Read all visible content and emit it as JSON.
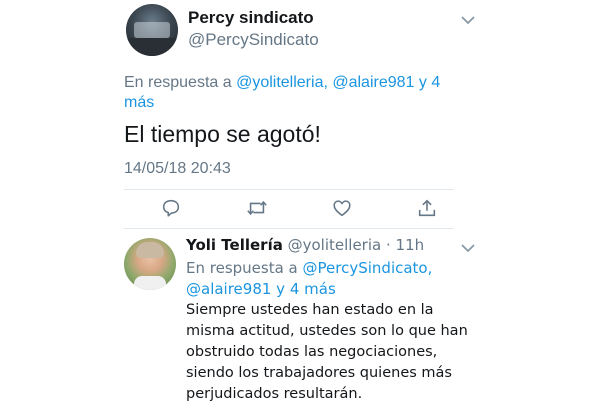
{
  "tweet": {
    "display_name": "Percy sindicato",
    "handle": "@PercySindicato",
    "reply_prefix": "En respuesta a",
    "reply_mentions": "@yolitelleria, @alaire981 y 4",
    "reply_more": "más",
    "text": "El tiempo se agotó!",
    "timestamp": "14/05/18 20:43",
    "actions": [
      "reply-icon",
      "retweet-icon",
      "like-icon",
      "share-icon"
    ]
  },
  "reply": {
    "display_name": "Yoli Tellería",
    "handle": "@yolitelleria",
    "separator": "·",
    "age": "11h",
    "reply_prefix": "En respuesta a",
    "reply_mention_1": "@PercySindicato,",
    "reply_mention_2": "@alaire981 y 4 más",
    "text_lines": [
      "Siempre ustedes han estado en la",
      "misma actitud, ustedes son lo que han",
      "obstruido todas las negociaciones,",
      "siendo los trabajadores quienes más",
      "perjudicados resultarán."
    ]
  },
  "colors": {
    "link": "#1b95e0",
    "secondary_text": "#657786",
    "divider": "#e1e8ed"
  }
}
